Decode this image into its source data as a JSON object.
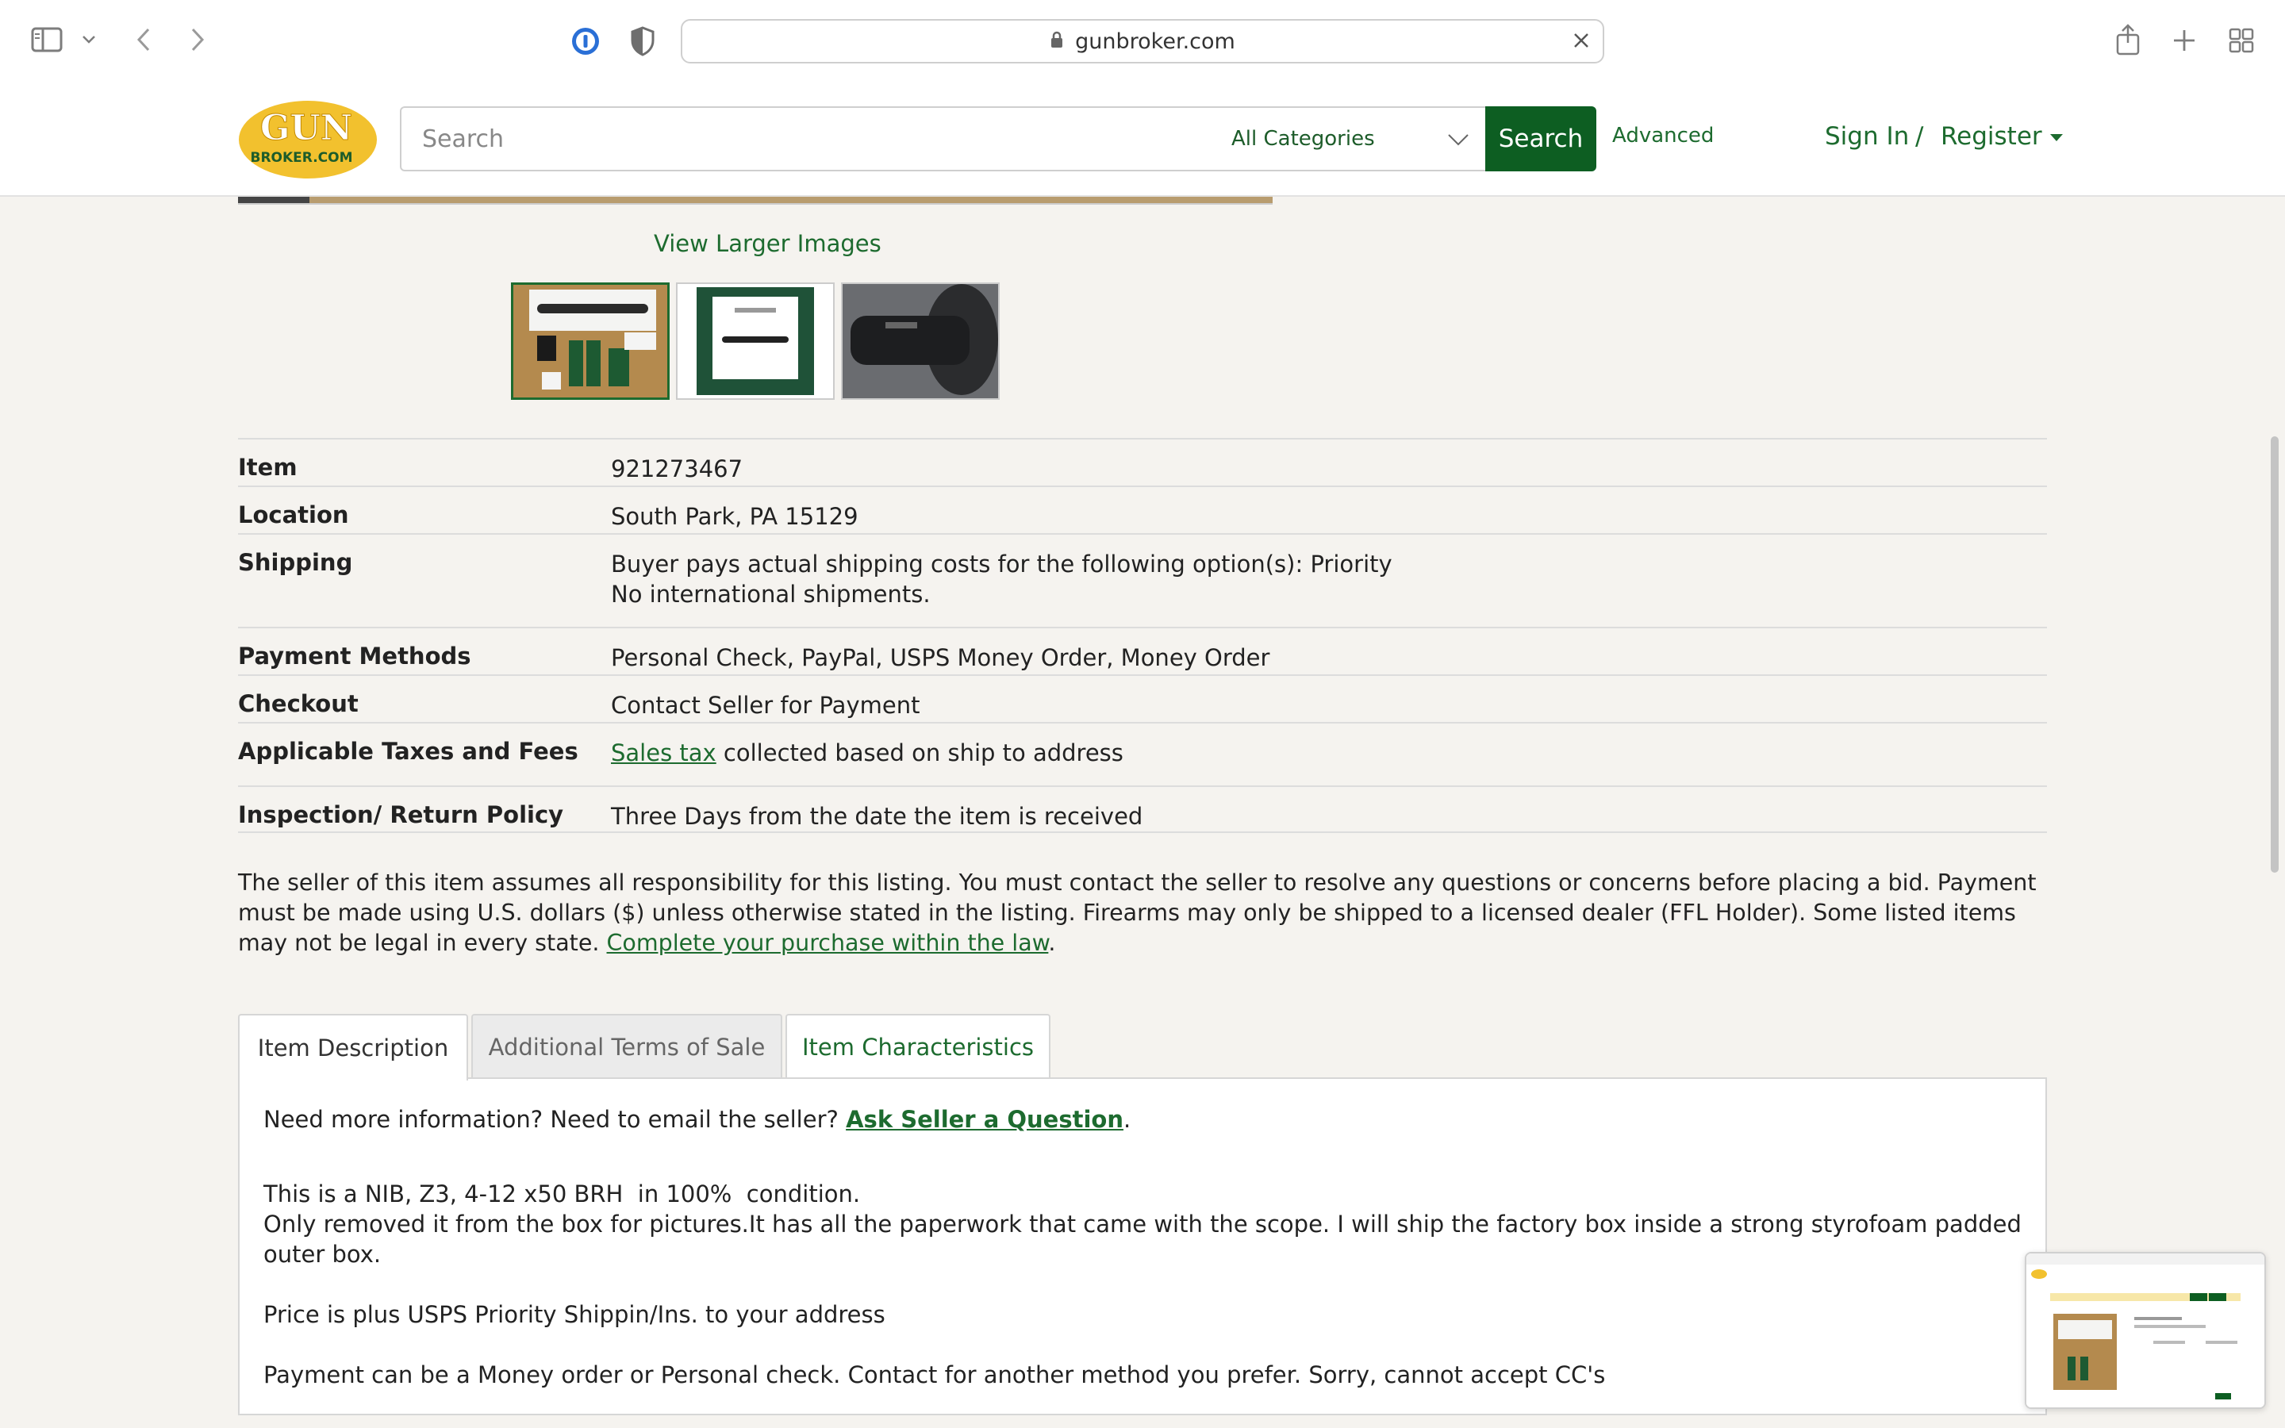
{
  "browser": {
    "url": "gunbroker.com"
  },
  "header": {
    "logo_top": "GUN",
    "logo_bottom": "BROKER.COM",
    "search_placeholder": "Search",
    "category_selected": "All Categories",
    "search_button": "Search",
    "advanced": "Advanced",
    "sign_in": "Sign In",
    "separator": "/",
    "register": "Register"
  },
  "gallery": {
    "view_larger": "View Larger Images"
  },
  "details": [
    {
      "label": "Item",
      "value": "921273467"
    },
    {
      "label": "Location",
      "value": "South Park, PA 15129"
    },
    {
      "label": "Shipping",
      "value": "Buyer pays actual shipping costs for the following option(s): Priority",
      "value2": "No international shipments."
    },
    {
      "label": "Payment Methods",
      "value": "Personal Check, PayPal, USPS Money Order, Money Order"
    },
    {
      "label": "Checkout",
      "value": "Contact Seller for Payment"
    },
    {
      "label": "Applicable Taxes and Fees",
      "link": "Sales tax",
      "value": " collected based on ship to address"
    },
    {
      "label": "Inspection/ Return Policy",
      "value": "Three Days from the date the item is received"
    }
  ],
  "disclaimer": {
    "text": "The seller of this item assumes all responsibility for this listing. You must contact the seller to resolve any questions or concerns before placing a bid. Payment must be made using U.S. dollars ($) unless otherwise stated in the listing. Firearms may only be shipped to a licensed dealer (FFL Holder). Some listed items may not be legal in every state.",
    "link": "Complete your purchase within the law",
    "end": "."
  },
  "tabs": [
    {
      "label": "Item Description"
    },
    {
      "label": "Additional Terms of Sale"
    },
    {
      "label": "Item Characteristics"
    }
  ],
  "description": {
    "prompt": "Need more information? Need to email the seller? ",
    "ask_link": "Ask Seller a Question",
    "prompt_end": ".",
    "line1": "This is a NIB, Z3, 4-12 x50 BRH  in 100%  condition.",
    "line2": "Only removed it from the box for pictures.It has all the paperwork that came with the scope. I will ship the factory box inside a strong styrofoam padded outer box.",
    "line3": "Price is plus USPS Priority Shippin/Ins. to your address",
    "line4": "Payment can be a Money order or Personal check. Contact for another method you prefer. Sorry, cannot accept CC's"
  },
  "colors": {
    "brand_green": "#0d5e22",
    "link_green": "#1d6b2f",
    "logo_yellow": "#f2c12e"
  }
}
